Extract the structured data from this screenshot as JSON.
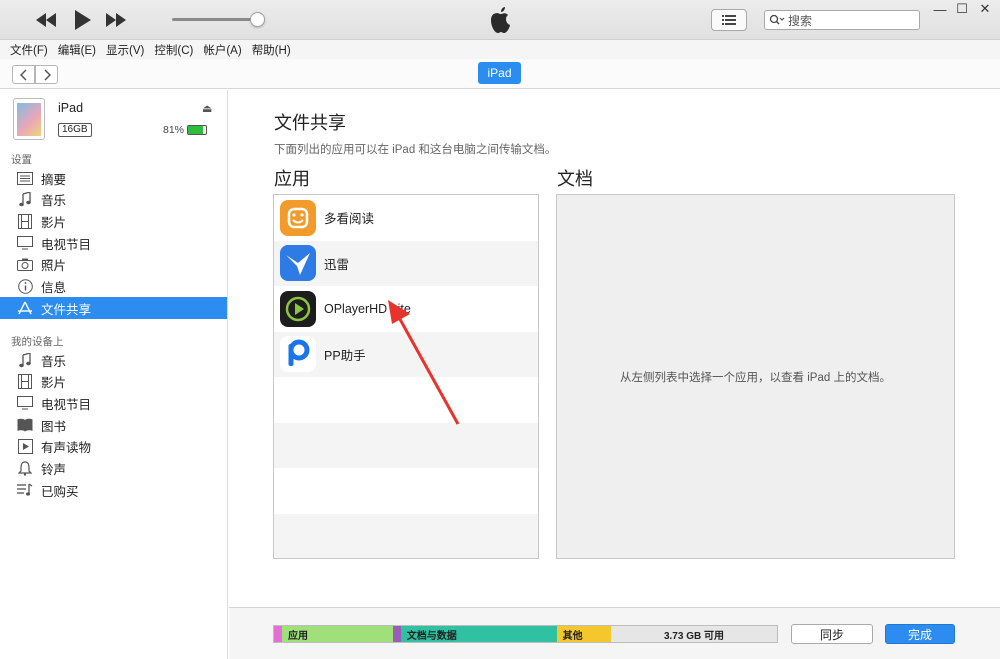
{
  "menubar": [
    "文件(F)",
    "编辑(E)",
    "显示(V)",
    "控制(C)",
    "帐户(A)",
    "帮助(H)"
  ],
  "search": {
    "placeholder": "搜索"
  },
  "nav": {
    "device_pill": "iPad"
  },
  "device": {
    "name": "iPad",
    "capacity": "16GB",
    "battery": "81%",
    "battery_level": 0.81
  },
  "sidebar": {
    "settings_label": "设置",
    "settings_items": [
      {
        "label": "摘要",
        "icon": "summary-icon"
      },
      {
        "label": "音乐",
        "icon": "music-icon"
      },
      {
        "label": "影片",
        "icon": "film-icon"
      },
      {
        "label": "电视节目",
        "icon": "tv-icon"
      },
      {
        "label": "照片",
        "icon": "camera-icon"
      },
      {
        "label": "信息",
        "icon": "info-icon"
      },
      {
        "label": "文件共享",
        "icon": "app-store-icon",
        "active": true
      }
    ],
    "ondevice_label": "我的设备上",
    "ondevice_items": [
      {
        "label": "音乐",
        "icon": "music-icon"
      },
      {
        "label": "影片",
        "icon": "film-icon"
      },
      {
        "label": "电视节目",
        "icon": "tv-icon"
      },
      {
        "label": "图书",
        "icon": "book-icon"
      },
      {
        "label": "有声读物",
        "icon": "audiobook-icon"
      },
      {
        "label": "铃声",
        "icon": "bell-icon"
      },
      {
        "label": "已购买",
        "icon": "purchased-icon"
      }
    ]
  },
  "main": {
    "title": "文件共享",
    "subtitle": "下面列出的应用可以在 iPad 和这台电脑之间传输文档。",
    "apps_header": "应用",
    "docs_header": "文档",
    "apps": [
      {
        "name": "多看阅读",
        "color": "#f29b2a"
      },
      {
        "name": "迅雷",
        "color": "#2f7be6"
      },
      {
        "name": "OPlayerHD Lite",
        "color": "#1d1d1d"
      },
      {
        "name": "PP助手",
        "color": "#ffffff"
      }
    ],
    "docs_placeholder": "从左侧列表中选择一个应用，以查看 iPad 上的文档。"
  },
  "storage": [
    {
      "label": "",
      "color": "#e36fd6",
      "fraction": 0.016
    },
    {
      "label": "应用",
      "color": "#9fe07a",
      "fraction": 0.22
    },
    {
      "label": "",
      "color": "#9a5fb5",
      "fraction": 0.016
    },
    {
      "label": "文档与数据",
      "color": "#2fc1a1",
      "fraction": 0.31
    },
    {
      "label": "其他",
      "color": "#f4c72c",
      "fraction": 0.108
    },
    {
      "label": "3.73 GB 可用",
      "color": "#e6e6e6",
      "fraction": 0.33
    }
  ],
  "buttons": {
    "sync": "同步",
    "done": "完成"
  }
}
